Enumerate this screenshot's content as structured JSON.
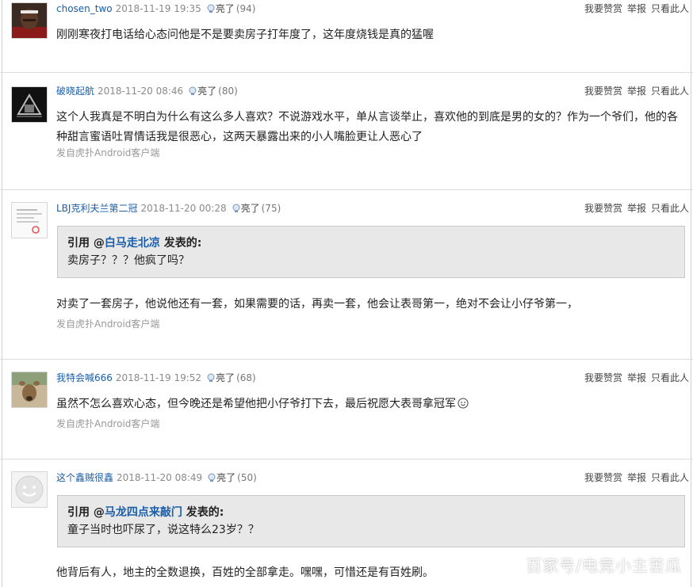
{
  "actions": {
    "reward": "我要赞赏",
    "report": "举报",
    "only_this": "只看此人"
  },
  "light_label": "亮了",
  "client_text": "发自虎扑Android客户端",
  "quote_prefix": "引用 @",
  "quote_suffix": " 发表的:",
  "posts": [
    {
      "user": "chosen_two",
      "date": "2018-11-19 19:35",
      "count": "(94)",
      "body": "刚刚寒夜打电话给心态问他是不是要卖房子打年度了，这年度烧钱是真的猛喔"
    },
    {
      "user": "破晓起航",
      "date": "2018-11-20 08:46",
      "count": "(80)",
      "body": "这个人我真是不明白为什么有这么多人喜欢？不说游戏水平，单从言谈举止，喜欢他的到底是男的女的？作为一个爷们，他的各种甜言蜜语吐胃情话我是很恶心，这两天暴露出来的小人嘴脸更让人恶心了"
    },
    {
      "user": "LBJ克利夫兰第二冠",
      "date": "2018-11-20 00:28",
      "count": "(75)",
      "quote_user": "白马走北凉",
      "quote_text": "卖房子？？？他疯了吗？",
      "body": "对卖了一套房子，他说他还有一套，如果需要的话，再卖一套，他会让表哥第一，绝对不会让小仔爷第一，"
    },
    {
      "user": "我特会喊666",
      "date": "2018-11-19 19:52",
      "count": "(68)",
      "body": "虽然不怎么喜欢心态，但今晚还是希望他把小仔爷打下去，最后祝愿大表哥拿冠军"
    },
    {
      "user": "这个鑫贼很鑫",
      "date": "2018-11-20 08:49",
      "count": "(50)",
      "quote_user": "马龙四点来敲门",
      "quote_text": "童子当时也吓尿了，说这特么23岁？？",
      "body": "他背后有人，地主的全数退换，百姓的全部拿走。嘿嘿，可惜还是有百姓刷。"
    }
  ],
  "watermark": "百家号/电竞小主苦瓜"
}
